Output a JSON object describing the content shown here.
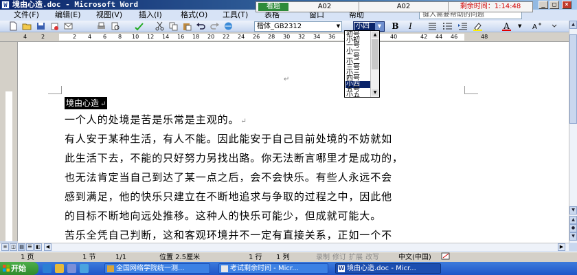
{
  "window": {
    "title": "境由心造.doc - Microsoft Word",
    "app_icon": "W",
    "minimize_label": "_",
    "maximize_label": "□",
    "close_label": "×"
  },
  "exam_bar": {
    "start_label": "看题",
    "question1": "A02",
    "question2": "A02",
    "timer": "剩余时间：1:14:48"
  },
  "menu": {
    "items": [
      "文件(F)",
      "编辑(E)",
      "视图(V)",
      "插入(I)",
      "格式(O)",
      "工具(T)",
      "表格",
      "窗口",
      "帮助"
    ],
    "help_placeholder": "键入需要帮助的问题"
  },
  "toolbar": {
    "font_name": "楷体_GB2312",
    "font_size": "小四",
    "bold_label": "B",
    "italic_label": "I",
    "font_color": "A",
    "icons": [
      "new-icon",
      "open-icon",
      "save-icon",
      "permission-icon",
      "email-icon",
      "print-icon",
      "print-preview-icon",
      "spelling-icon",
      "cut-icon",
      "copy-icon",
      "paste-icon",
      "undo-icon",
      "redo-icon",
      "hyperlink-icon"
    ]
  },
  "font_size_list": {
    "items": [
      "初号",
      "小初",
      "一号",
      "小一",
      "二号",
      "小二",
      "三号",
      "小三",
      "四号",
      "小四",
      "五号",
      "小五"
    ],
    "selected": "小四"
  },
  "ruler": {
    "labels": [
      "4",
      "2",
      "2",
      "4",
      "6",
      "8",
      "10",
      "12",
      "14",
      "16",
      "18",
      "20",
      "22",
      "24",
      "26",
      "28",
      "30",
      "32",
      "34",
      "36",
      "38",
      "40",
      "42",
      "44",
      "46",
      "48"
    ]
  },
  "document": {
    "paragraph_mark": "↵",
    "heading": "境由心造",
    "lines": [
      "一个人的处境是苦是乐常是主观的。",
      "有人安于某种生活，有人不能。因此能安于自己目前处境的不妨就如",
      "此生活下去，不能的只好努力另找出路。你无法断言哪里才是成功的，",
      "也无法肯定当自己到达了某一点之后，会不会快乐。有些人永远不会",
      "感到满足，他的快乐只建立在不断地追求与争取的过程之中，因此他",
      "的目标不断地向远处推移。这种人的快乐可能少，但成就可能大。",
      "苦乐全凭自己判断，这和客观环境并不一定有直接关系，正如一个不"
    ]
  },
  "statusbar": {
    "page": "1 页",
    "section": "1 节",
    "page_count": "1/1",
    "position": "位置 2.5厘米",
    "line": "1 行",
    "column": "1 列",
    "rec": "录制",
    "trk": "修订",
    "ext": "扩展",
    "ovr": "改写",
    "language": "中文(中国)"
  },
  "taskbar": {
    "start_label": "开始",
    "tasks": [
      "全国网络学院统一测...",
      "考试剩余时间 - Micr...",
      "境由心造.doc - Micr..."
    ],
    "active_index": 2
  },
  "colors": {
    "titlebar": "#0a246a",
    "exam_start": "#2e8b3a",
    "timer_text": "#d00000",
    "selection": "#0a246a",
    "taskbar": "#1f56c8",
    "start_button": "#2f8a2c",
    "font_color_bar": "#e00000"
  }
}
